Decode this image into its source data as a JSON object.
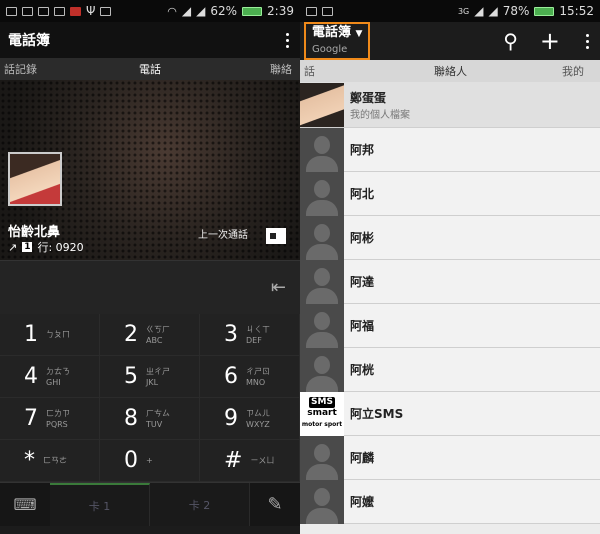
{
  "left": {
    "status": {
      "battery": "62%",
      "time": "2:39"
    },
    "title": "電話簿",
    "tabs": [
      "話記錄",
      "電話",
      "聯絡"
    ],
    "hero": {
      "name": "怡齡北鼻",
      "line": "行: 0920",
      "last_call": "上一次通話",
      "sim_num": "1"
    },
    "keys": [
      {
        "d": "1",
        "s1": "ㄅㄆㄇ",
        "s2": ""
      },
      {
        "d": "2",
        "s1": "ㄍㄎㄏ",
        "s2": "ABC"
      },
      {
        "d": "3",
        "s1": "ㄐㄑㄒ",
        "s2": "DEF"
      },
      {
        "d": "4",
        "s1": "ㄉㄊㄋ",
        "s2": "GHI"
      },
      {
        "d": "5",
        "s1": "ㄓㄔㄕ",
        "s2": "JKL"
      },
      {
        "d": "6",
        "s1": "ㄔㄕㄖ",
        "s2": "MNO"
      },
      {
        "d": "7",
        "s1": "ㄈㄌㄗ",
        "s2": "PQRS"
      },
      {
        "d": "8",
        "s1": "ㄏㄘㄙ",
        "s2": "TUV"
      },
      {
        "d": "9",
        "s1": "ㄗㄙㄦ",
        "s2": "WXYZ"
      },
      {
        "d": "*",
        "s1": "ㄈㄢㄜ",
        "s2": ""
      },
      {
        "d": "0",
        "s1": "+",
        "s2": ""
      },
      {
        "d": "#",
        "s1": "ㄧㄨㄩ",
        "s2": ""
      }
    ],
    "bottom": {
      "sim1": "卡 1",
      "sim2": "卡 2"
    }
  },
  "right": {
    "status": {
      "battery": "78%",
      "time": "15:52",
      "net": "3G"
    },
    "title": "電話簿",
    "account": "Google",
    "tabs": [
      "話",
      "聯絡人",
      "我的"
    ],
    "contacts": [
      {
        "name": "鄭蛋蛋",
        "sub": "我的個人檔案",
        "type": "me"
      },
      {
        "name": "阿邦",
        "type": "default"
      },
      {
        "name": "阿北",
        "type": "default"
      },
      {
        "name": "阿彬",
        "type": "default"
      },
      {
        "name": "阿達",
        "type": "default"
      },
      {
        "name": "阿福",
        "type": "default"
      },
      {
        "name": "阿桄",
        "type": "default"
      },
      {
        "name": "阿立SMS",
        "type": "sms"
      },
      {
        "name": "阿麟",
        "type": "default"
      },
      {
        "name": "阿嬤",
        "type": "default"
      }
    ],
    "sms_logo": {
      "l1": "SMS",
      "l2": "smart",
      "l3": "motor sport"
    }
  }
}
